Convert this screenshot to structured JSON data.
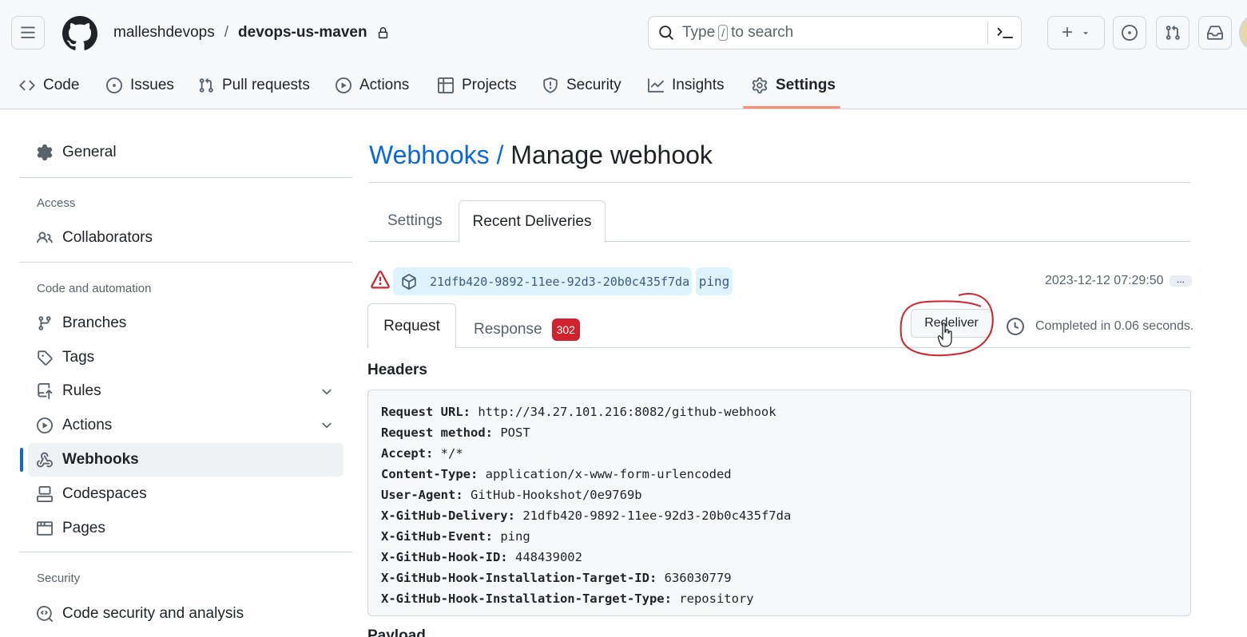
{
  "header": {
    "owner": "malleshdevops",
    "separator": "/",
    "repo": "devops-us-maven",
    "search": {
      "prefix": "Type",
      "key": "/",
      "suffix": "to search"
    },
    "plus_label": "+"
  },
  "repo_tabs": [
    {
      "label": "Code",
      "icon": "code-icon"
    },
    {
      "label": "Issues",
      "icon": "issue-icon"
    },
    {
      "label": "Pull requests",
      "icon": "pull-request-icon"
    },
    {
      "label": "Actions",
      "icon": "play-icon"
    },
    {
      "label": "Projects",
      "icon": "table-icon"
    },
    {
      "label": "Security",
      "icon": "shield-icon"
    },
    {
      "label": "Insights",
      "icon": "graph-icon"
    },
    {
      "label": "Settings",
      "icon": "gear-icon",
      "active": true
    }
  ],
  "sidebar": {
    "general": "General",
    "sections": [
      {
        "heading": "Access",
        "items": [
          "Collaborators"
        ]
      },
      {
        "heading": "Code and automation",
        "items": [
          "Branches",
          "Tags",
          "Rules",
          "Actions",
          "Webhooks",
          "Codespaces",
          "Pages"
        ]
      },
      {
        "heading": "Security",
        "items": [
          "Code security and analysis"
        ]
      }
    ],
    "active_item": "Webhooks"
  },
  "main": {
    "title_link": "Webhooks",
    "title_sep": "/",
    "title_rest": "Manage webhook",
    "subtabs": [
      "Settings",
      "Recent Deliveries"
    ],
    "active_subtab": "Recent Deliveries",
    "delivery": {
      "guid": "21dfb420-9892-11ee-92d3-20b0c435f7da",
      "event": "ping",
      "timestamp": "2023-12-12 07:29:50",
      "more": "..."
    },
    "request_tabs": {
      "request": "Request",
      "response": "Response",
      "status_code": "302"
    },
    "redeliver_label": "Redeliver",
    "completed_text": "Completed in 0.06 seconds.",
    "headers_title": "Headers",
    "headers": [
      {
        "key": "Request URL:",
        "value": "http://34.27.101.216:8082/github-webhook"
      },
      {
        "key": "Request method:",
        "value": "POST"
      },
      {
        "key": "Accept:",
        "value": "*/*"
      },
      {
        "key": "Content-Type:",
        "value": "application/x-www-form-urlencoded"
      },
      {
        "key": "User-Agent:",
        "value": "GitHub-Hookshot/0e9769b"
      },
      {
        "key": "X-GitHub-Delivery:",
        "value": "21dfb420-9892-11ee-92d3-20b0c435f7da"
      },
      {
        "key": "X-GitHub-Event:",
        "value": "ping"
      },
      {
        "key": "X-GitHub-Hook-ID:",
        "value": "448439002"
      },
      {
        "key": "X-GitHub-Hook-Installation-Target-ID:",
        "value": "636030779"
      },
      {
        "key": "X-GitHub-Hook-Installation-Target-Type:",
        "value": "repository"
      }
    ],
    "payload_title": "Payload"
  },
  "colors": {
    "accent": "#0969da",
    "tab_underline": "#fd8c73",
    "danger": "#cf222e",
    "annotation": "#d1242f"
  }
}
